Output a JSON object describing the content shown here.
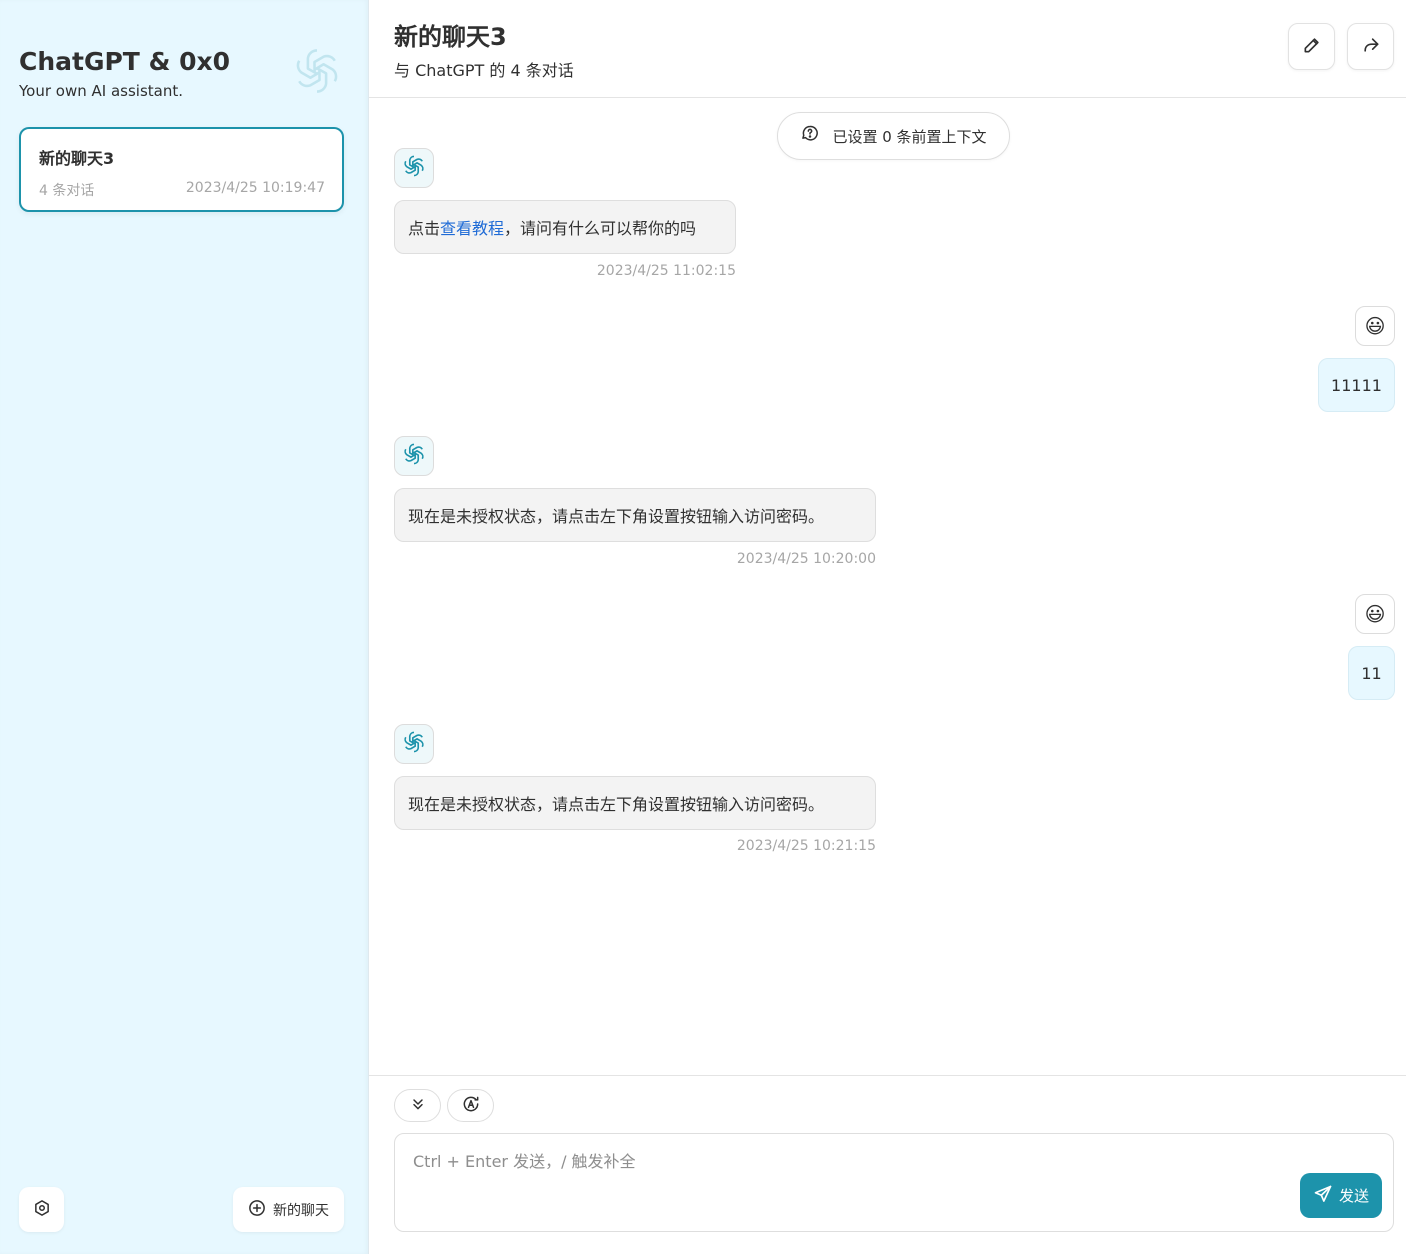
{
  "sidebar": {
    "title": "ChatGPT & 0x0",
    "subtitle": "Your own AI assistant.",
    "chats": [
      {
        "title": "新的聊天3",
        "count": "4 条对话",
        "date": "2023/4/25 10:19:47",
        "active": true
      }
    ],
    "settings_icon": "gear-icon",
    "new_chat_label": "新的聊天"
  },
  "header": {
    "title": "新的聊天3",
    "subtitle": "与 ChatGPT 的 4 条对话",
    "edit_icon": "pencil-icon",
    "share_icon": "share-icon"
  },
  "context": {
    "label": "已设置 0 条前置上下文"
  },
  "messages": [
    {
      "role": "bot",
      "prefix": "点击",
      "link": "查看教程",
      "suffix": "，请问有什么可以帮你的吗",
      "time": "2023/4/25 11:02:15"
    },
    {
      "role": "user",
      "text": "11111",
      "avatar": "😃"
    },
    {
      "role": "bot",
      "text": "现在是未授权状态，请点击左下角设置按钮输入访问密码。",
      "time": "2023/4/25 10:20:00"
    },
    {
      "role": "user",
      "text": "11",
      "avatar": "😃"
    },
    {
      "role": "bot",
      "text": "现在是未授权状态，请点击左下角设置按钮输入访问密码。",
      "time": "2023/4/25 10:21:15"
    }
  ],
  "input": {
    "placeholder": "Ctrl + Enter 发送，/ 触发补全",
    "send_label": "发送"
  },
  "colors": {
    "accent": "#1d93ab",
    "sidebar_bg": "#e7f8ff",
    "bot_bubble": "#f3f3f3",
    "user_bubble": "#e7f8ff",
    "link": "#1f6bd6"
  }
}
